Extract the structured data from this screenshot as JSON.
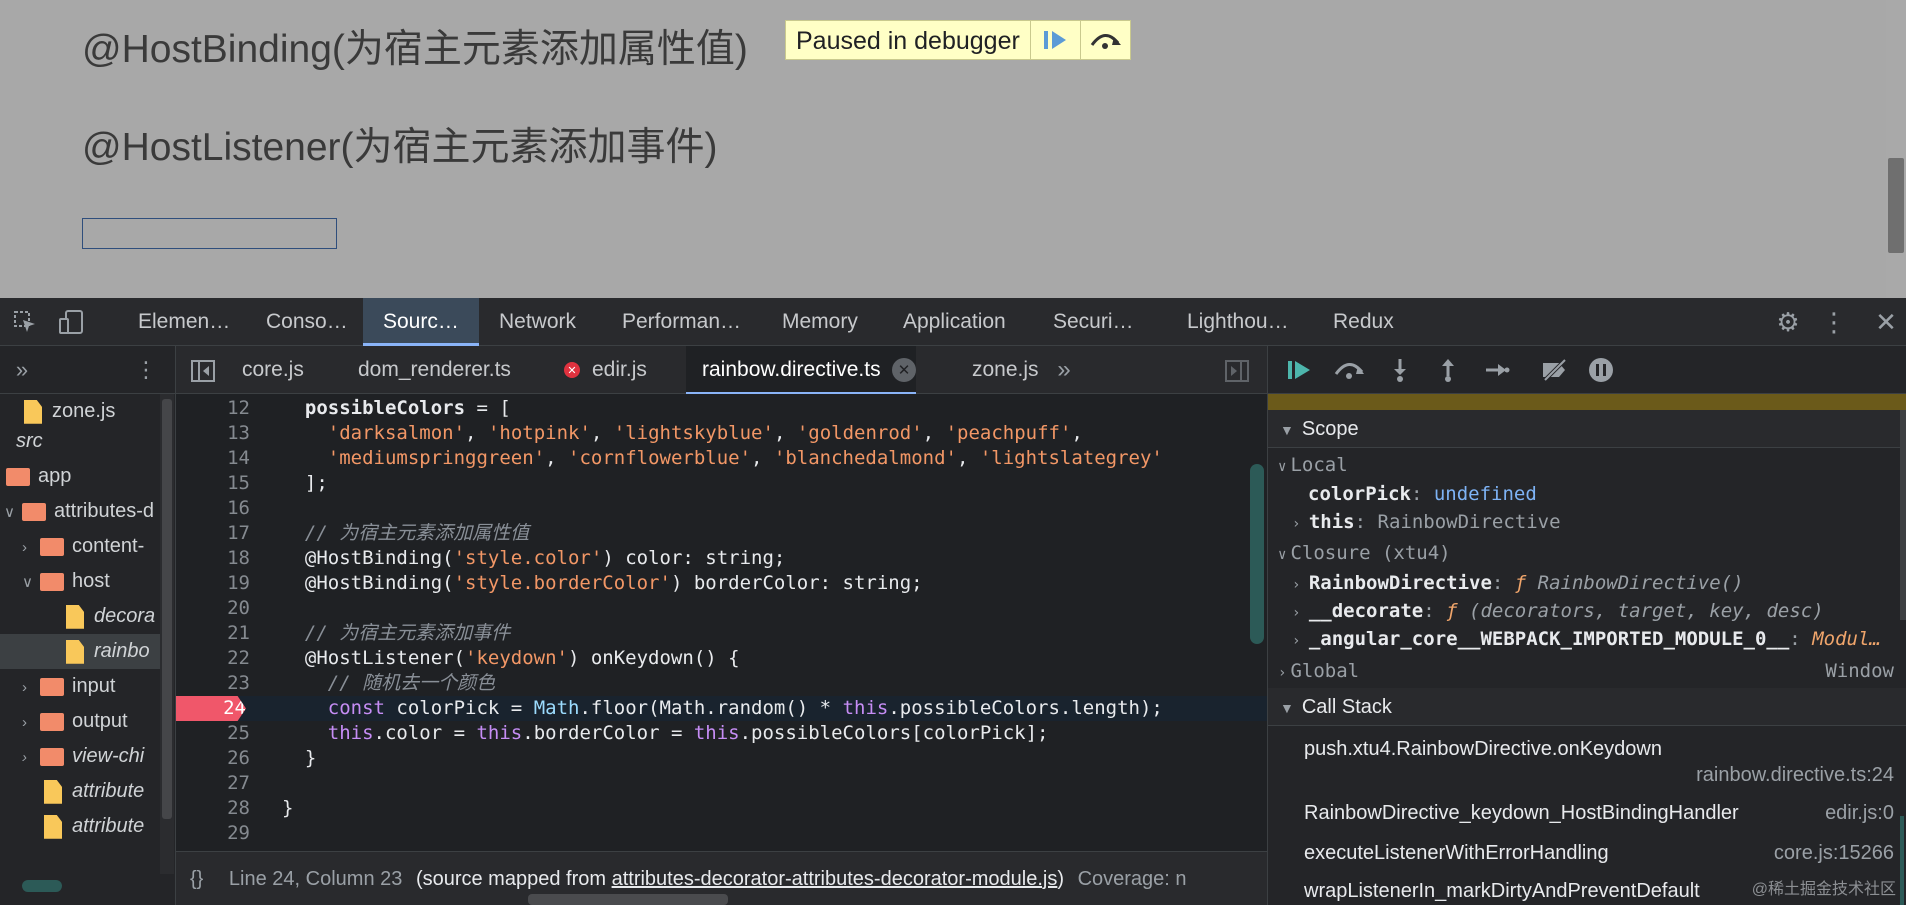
{
  "page": {
    "heading1": "@HostBinding(为宿主元素添加属性值)",
    "heading2": "@HostListener(为宿主元素添加事件)",
    "paused_banner": "Paused in debugger"
  },
  "devtools_tabs": [
    "Elemen…",
    "Conso…",
    "Sourc…",
    "Network",
    "Performan…",
    "Memory",
    "Application",
    "Securi…",
    "Lighthou…",
    "Redux"
  ],
  "navigator": {
    "items": [
      {
        "label": "zone.js",
        "kind": "file"
      },
      {
        "label": "src",
        "kind": "text"
      },
      {
        "label": "app",
        "kind": "folder"
      },
      {
        "label": "attributes-d",
        "kind": "folder"
      },
      {
        "label": "content-",
        "kind": "folder"
      },
      {
        "label": "host",
        "kind": "folder"
      },
      {
        "label": "decora",
        "kind": "file"
      },
      {
        "label": "rainbo",
        "kind": "file"
      },
      {
        "label": "input",
        "kind": "folder"
      },
      {
        "label": "output",
        "kind": "folder"
      },
      {
        "label": "view-chi",
        "kind": "folder"
      },
      {
        "label": "attribute",
        "kind": "file"
      },
      {
        "label": "attribute",
        "kind": "file"
      }
    ]
  },
  "editor": {
    "tabs": [
      "core.js",
      "dom_renderer.ts",
      "edir.js",
      "rainbow.directive.ts",
      "zone.js"
    ],
    "active_tab": "rainbow.directive.ts",
    "lines": [
      {
        "n": "12",
        "text": "  possibleColors = ["
      },
      {
        "n": "13",
        "text": "    'darksalmon', 'hotpink', 'lightskyblue', 'goldenrod', 'peachpuff',"
      },
      {
        "n": "14",
        "text": "    'mediumspringgreen', 'cornflowerblue', 'blanchedalmond', 'lightslategrey'"
      },
      {
        "n": "15",
        "text": "  ];"
      },
      {
        "n": "16",
        "text": ""
      },
      {
        "n": "17",
        "text": "  // 为宿主元素添加属性值"
      },
      {
        "n": "18",
        "text": "  @HostBinding('style.color') color: string;"
      },
      {
        "n": "19",
        "text": "  @HostBinding('style.borderColor') borderColor: string;"
      },
      {
        "n": "20",
        "text": ""
      },
      {
        "n": "21",
        "text": "  // 为宿主元素添加事件"
      },
      {
        "n": "22",
        "text": "  @HostListener('keydown') onKeydown() {"
      },
      {
        "n": "23",
        "text": "    // 随机去一个颜色"
      },
      {
        "n": "24",
        "text": "    const colorPick = Math.floor(Math.random() * this.possibleColors.length);"
      },
      {
        "n": "25",
        "text": "    this.color = this.borderColor = this.possibleColors[colorPick];"
      },
      {
        "n": "26",
        "text": "  }"
      },
      {
        "n": "27",
        "text": ""
      },
      {
        "n": "28",
        "text": "}"
      },
      {
        "n": "29",
        "text": ""
      }
    ],
    "status": {
      "position": "Line 24, Column 23",
      "mapped_prefix": "(source mapped from ",
      "mapped_link": "attributes-decorator-attributes-decorator-module.js",
      "mapped_suffix": ")",
      "coverage": "Coverage: n"
    }
  },
  "debugger": {
    "scope_title": "Scope",
    "local_title": "Local",
    "local": [
      {
        "key": "colorPick",
        "value": "undefined"
      },
      {
        "key": "this",
        "value": "RainbowDirective"
      }
    ],
    "closure_title": "Closure (xtu4)",
    "closure": [
      {
        "key": "RainbowDirective",
        "value": "RainbowDirective()"
      },
      {
        "key": "__decorate",
        "value": "(decorators, target, key, desc)"
      },
      {
        "key": "_angular_core__WEBPACK_IMPORTED_MODULE_0__",
        "value": "Modul…"
      }
    ],
    "global_title": "Global",
    "global_value": "Window",
    "callstack_title": "Call Stack",
    "callstack": [
      {
        "fn": "push.xtu4.RainbowDirective.onKeydown",
        "loc": "rainbow.directive.ts:24"
      },
      {
        "fn": "RainbowDirective_keydown_HostBindingHandler",
        "loc": "edir.js:0"
      },
      {
        "fn": "executeListenerWithErrorHandling",
        "loc": "core.js:15266"
      },
      {
        "fn": "wrapListenerIn_markDirtyAndPreventDefault",
        "loc": ""
      }
    ]
  },
  "watermark": "@稀土掘金技术社区",
  "colors": {
    "accent": "#8ab4f8",
    "breakpoint": "#f0576a",
    "string": "#f29766"
  }
}
